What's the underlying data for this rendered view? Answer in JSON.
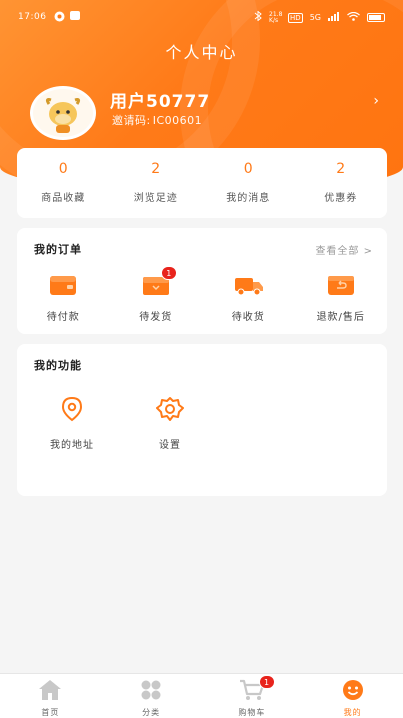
{
  "status_bar": {
    "time": "17:06",
    "net_speed": "21.8\nK/s",
    "network": "5G"
  },
  "header": {
    "title": "个人中心"
  },
  "profile": {
    "name": "用户50777",
    "invite_label": "邀请码:",
    "invite_code": "IC00601"
  },
  "stats": [
    {
      "value": "0",
      "label": "商品收藏"
    },
    {
      "value": "2",
      "label": "浏览足迹"
    },
    {
      "value": "0",
      "label": "我的消息"
    },
    {
      "value": "2",
      "label": "优惠券"
    }
  ],
  "orders": {
    "title": "我的订单",
    "see_all": "查看全部 >",
    "items": [
      {
        "label": "待付款",
        "icon": "wallet-icon"
      },
      {
        "label": "待发货",
        "icon": "package-icon",
        "badge": "1"
      },
      {
        "label": "待收货",
        "icon": "truck-icon"
      },
      {
        "label": "退款/售后",
        "icon": "refund-icon"
      }
    ]
  },
  "functions": {
    "title": "我的功能",
    "items": [
      {
        "label": "我的地址",
        "icon": "location-pin-icon"
      },
      {
        "label": "设置",
        "icon": "gear-icon"
      }
    ]
  },
  "tabbar": {
    "items": [
      {
        "label": "首页",
        "icon": "home-icon"
      },
      {
        "label": "分类",
        "icon": "category-icon"
      },
      {
        "label": "购物车",
        "icon": "cart-icon",
        "badge": "1"
      },
      {
        "label": "我的",
        "icon": "smile-icon",
        "active": true
      }
    ]
  },
  "colors": {
    "accent": "#ff7a18",
    "badge": "#e8231c",
    "background": "#f5f5f5"
  }
}
